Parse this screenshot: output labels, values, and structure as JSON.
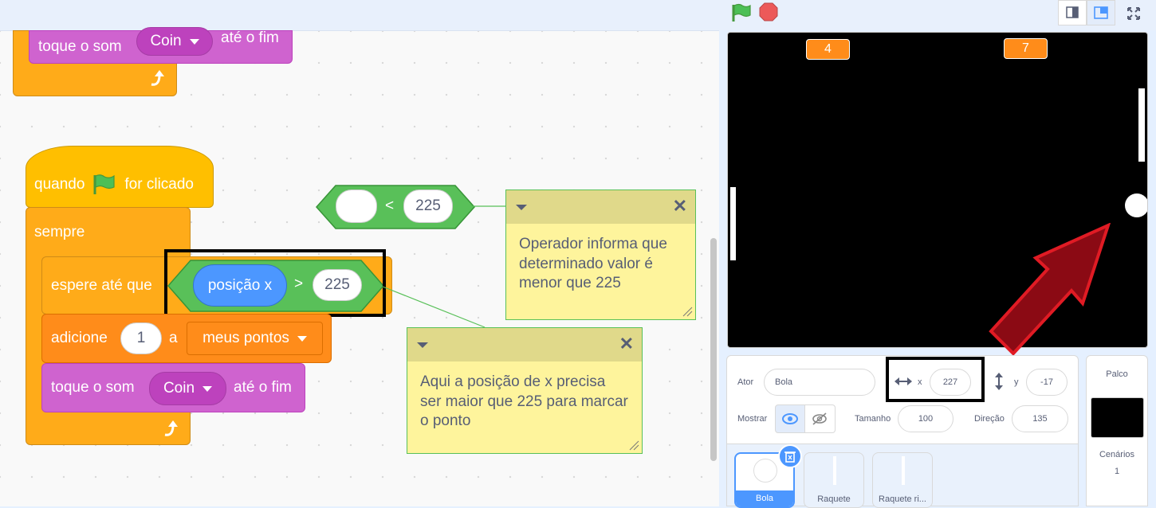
{
  "script_top": {
    "play_sound_label": "toque o som",
    "sound_name": "Coin",
    "until_done_label": "até o fim"
  },
  "script_main": {
    "when_label": "quando",
    "clicked_label": "for clicado",
    "forever_label": "sempre",
    "wait_until_label": "espere até que",
    "x_position_label": "posição x",
    "gt_symbol": ">",
    "gt_value": "225",
    "change_label": "adicione",
    "change_value": "1",
    "change_to_label": "a",
    "variable_name": "meus pontos",
    "play_sound_label": "toque o som",
    "sound_name": "Coin",
    "until_done_label": "até o fim"
  },
  "loose_block": {
    "lt_symbol": "<",
    "lt_value": "225"
  },
  "notes": [
    {
      "text": "Operador informa que determinado valor é menor que 225"
    },
    {
      "text": "Aqui a posição de x precisa ser maior que 225 para marcar o ponto"
    }
  ],
  "stage": {
    "score_left": "4",
    "score_right": "7"
  },
  "sprite_info": {
    "sprite_label": "Ator",
    "sprite_name": "Bola",
    "x_label": "x",
    "x_value": "227",
    "y_label": "y",
    "y_value": "-17",
    "show_label": "Mostrar",
    "size_label": "Tamanho",
    "size_value": "100",
    "direction_label": "Direção",
    "direction_value": "135"
  },
  "sprites": [
    {
      "name": "Bola",
      "selected": true
    },
    {
      "name": "Raquete",
      "selected": false
    },
    {
      "name": "Raquete ri...",
      "selected": false
    }
  ],
  "stage_pane": {
    "title": "Palco",
    "backdrops_label": "Cenários",
    "backdrops_count": "1"
  },
  "colors": {
    "events": "#ffbf00",
    "control": "#ffab19",
    "sound": "#cf63cf",
    "variables": "#ff8c1a",
    "operators": "#59c059",
    "motion": "#4c97ff",
    "highlight_arrow": "#8b0a14"
  },
  "icons": {
    "green_flag": "green-flag-icon",
    "stop": "stop-icon",
    "turn_arrow": "loop-arrow-icon",
    "delete": "trash-icon"
  }
}
